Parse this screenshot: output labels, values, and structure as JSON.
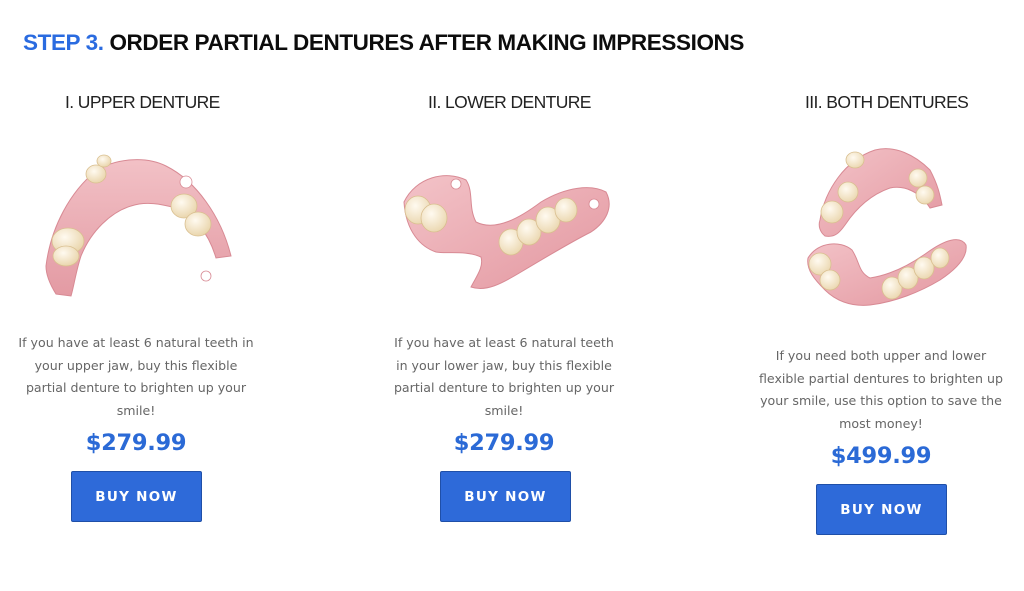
{
  "heading": {
    "step": "STEP 3.",
    "title": "ORDER PARTIAL DENTURES AFTER MAKING IMPRESSIONS"
  },
  "products": [
    {
      "title": "I. UPPER DENTURE",
      "description": [
        "If you have at least 6 natural teeth in",
        "your upper jaw, buy this flexible",
        "partial denture to brighten up your",
        "smile!"
      ],
      "price": "$279.99",
      "button": "BUY NOW"
    },
    {
      "title": "II. LOWER DENTURE",
      "description": [
        "If you have at least 6 natural teeth",
        "in your lower jaw, buy this flexible",
        "partial denture to brighten up your",
        "smile!"
      ],
      "price": "$279.99",
      "button": "BUY NOW"
    },
    {
      "title": "III. BOTH DENTURES",
      "description": [
        "If you need both upper and lower",
        "flexible partial dentures to brighten up",
        "your smile, use this option to save the",
        "most money!"
      ],
      "price": "$499.99",
      "button": "BUY NOW"
    }
  ],
  "colors": {
    "accent": "#2a6be0",
    "button": "#2e6ad9",
    "price": "#2b6ad6",
    "gum": "#e9a7ae",
    "tooth": "#f6ecd6"
  },
  "icons": [
    "upper-denture-image",
    "lower-denture-image",
    "both-dentures-image"
  ]
}
